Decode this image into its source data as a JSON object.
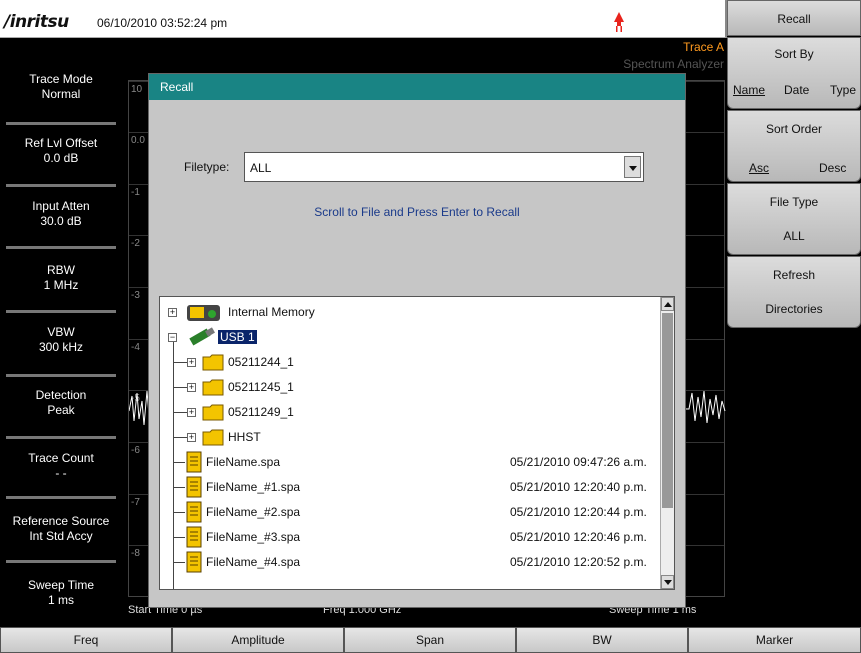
{
  "header": {
    "logo": "/inritsu",
    "datetime": "06/10/2010 03:52:24 pm",
    "trace": "Trace A",
    "mode": "Spectrum Analyzer"
  },
  "left_panel": [
    {
      "name": "Trace Mode",
      "value": "Normal"
    },
    {
      "name": "Ref Lvl Offset",
      "value": "0.0 dB"
    },
    {
      "name": "Input Atten",
      "value": "30.0 dB"
    },
    {
      "name": "RBW",
      "value": "1 MHz"
    },
    {
      "name": "VBW",
      "value": "300 kHz"
    },
    {
      "name": "Detection",
      "value": "Peak"
    },
    {
      "name": "Trace Count",
      "value": "- -"
    },
    {
      "name": "Reference Source",
      "value": "Int Std Accy"
    },
    {
      "name": "Sweep Time",
      "value": "1 ms"
    }
  ],
  "graticule": {
    "y_labels": [
      "10",
      "0.0",
      "-1",
      "-2",
      "-3",
      "-4",
      "-5",
      "-6",
      "-7",
      "-8"
    ],
    "start_time": "Start Time   0 µs",
    "center_freq": "Freq 1.000 GHz",
    "sweep_time": "Sweep Time   1 ms"
  },
  "right_menu": {
    "title": "Recall",
    "sort_by": {
      "label": "Sort By",
      "options": [
        "Name",
        "Date",
        "Type"
      ],
      "selected": "Name"
    },
    "sort_order": {
      "label": "Sort Order",
      "options": [
        "Asc",
        "Desc"
      ],
      "selected": "Asc"
    },
    "file_type": {
      "label": "File Type",
      "value": "ALL"
    },
    "refresh": {
      "label": "Refresh",
      "label2": "Directories"
    }
  },
  "bottom_buttons": [
    "Freq",
    "Amplitude",
    "Span",
    "BW",
    "Marker"
  ],
  "dialog": {
    "title": "Recall",
    "filetype_label": "Filetype:",
    "filetype_value": "ALL",
    "instruction": "Scroll to File and Press Enter to Recall",
    "tree": {
      "internal_memory": "Internal Memory",
      "usb": "USB 1",
      "folders": [
        "05211244_1",
        "05211245_1",
        "05211249_1",
        "HHST"
      ],
      "files": [
        {
          "name": "FileName.spa",
          "date": "05/21/2010 09:47:26 a.m."
        },
        {
          "name": "FileName_#1.spa",
          "date": "05/21/2010 12:20:40 p.m."
        },
        {
          "name": "FileName_#2.spa",
          "date": "05/21/2010 12:20:44 p.m."
        },
        {
          "name": "FileName_#3.spa",
          "date": "05/21/2010 12:20:46 p.m."
        },
        {
          "name": "FileName_#4.spa",
          "date": "05/21/2010 12:20:52 p.m."
        }
      ]
    }
  },
  "colors": {
    "dialog_title": "#198484",
    "trace_label": "#ff9a1f",
    "selection": "#0a246a",
    "power_icon": "#e8231c"
  }
}
